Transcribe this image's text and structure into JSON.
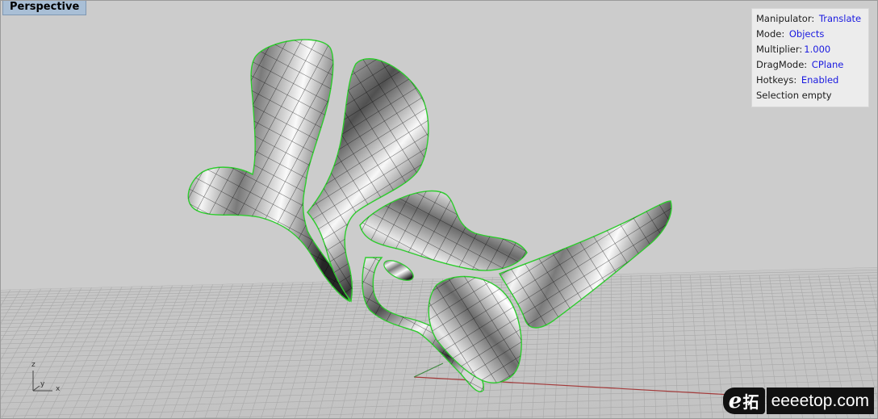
{
  "viewport": {
    "title": "Perspective"
  },
  "hud": {
    "manipulator_label": "Manipulator:",
    "manipulator_value": "Translate",
    "mode_label": "Mode:",
    "mode_value": "Objects",
    "multiplier_label": "Multiplier:",
    "multiplier_value": "1.000",
    "dragmode_label": "DragMode:",
    "dragmode_value": "CPlane",
    "hotkeys_label": "Hotkeys:",
    "hotkeys_value": "Enabled",
    "selection_text": "Selection empty"
  },
  "axis": {
    "z": "z",
    "y": "y",
    "x": "x"
  },
  "watermark": {
    "logo_letter": "e",
    "logo_cn": "拓",
    "site": "eeeetop.com"
  },
  "colors": {
    "background": "#c9c9c9",
    "grid": "#a9a9a9",
    "x_axis": "#a33a3a",
    "y_axis": "#3f8a3f",
    "selection_edge": "#2ecc2e",
    "title_bg": "#a9bfd6",
    "hud_value": "#1a1ae0"
  },
  "icons": [
    "axis-triad-icon"
  ]
}
